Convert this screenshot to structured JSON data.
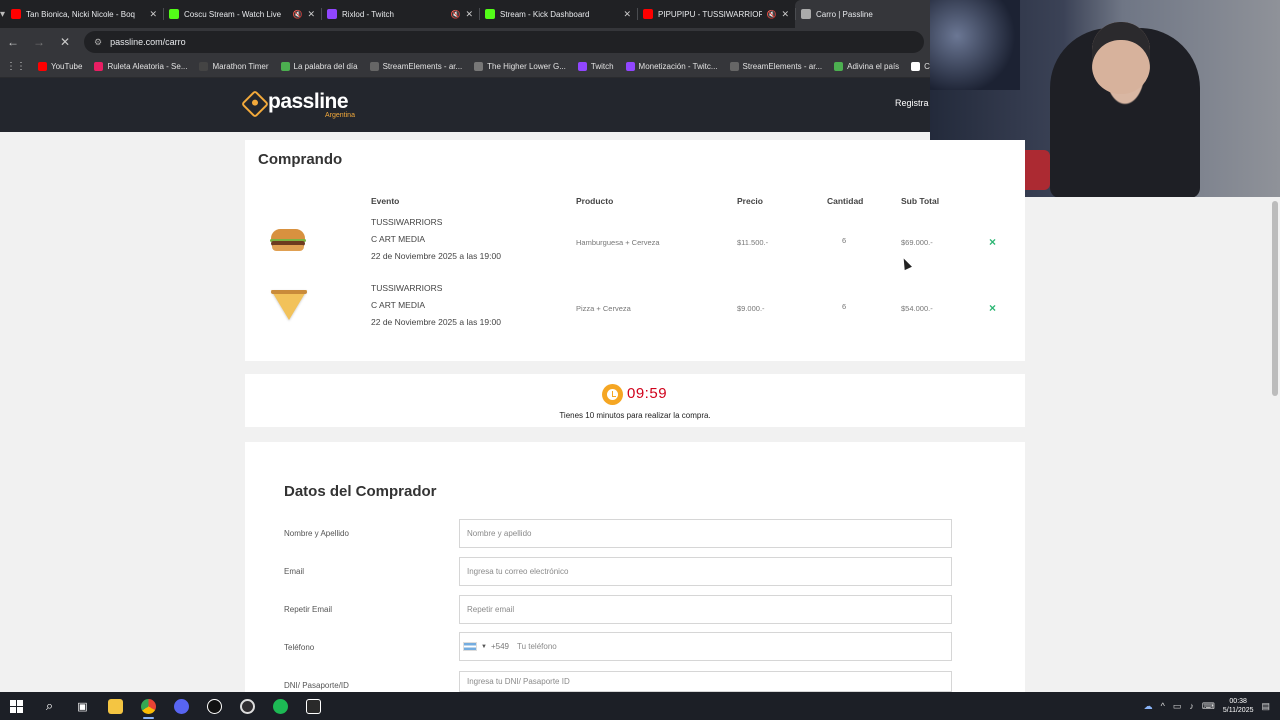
{
  "browser": {
    "tabs": [
      {
        "title": "Tan Bionica, Nicki Nicole - Boq",
        "favicon_color": "#ff0000",
        "muted": false,
        "active": false
      },
      {
        "title": "Coscu Stream - Watch Live",
        "favicon_color": "#53fc18",
        "muted": true,
        "active": false
      },
      {
        "title": "Rixlod - Twitch",
        "favicon_color": "#9146ff",
        "muted": true,
        "active": false
      },
      {
        "title": "Stream - Kick Dashboard",
        "favicon_color": "#53fc18",
        "muted": false,
        "active": false
      },
      {
        "title": "PIPUPIPU - TUSSIWARRIORS",
        "favicon_color": "#ff0000",
        "muted": true,
        "active": false
      },
      {
        "title": "Carro | Passline",
        "favicon_color": "#aaaaaa",
        "muted": false,
        "active": true
      }
    ],
    "url": "passline.com/carro",
    "bookmarks": [
      {
        "label": "YouTube",
        "color": "#ff0000"
      },
      {
        "label": "Ruleta Aleatoria - Se...",
        "color": "#e91e63"
      },
      {
        "label": "Marathon Timer",
        "color": "#444444"
      },
      {
        "label": "La palabra del día",
        "color": "#4caf50"
      },
      {
        "label": "StreamElements - ar...",
        "color": "#666666"
      },
      {
        "label": "The Higher Lower G...",
        "color": "#777777"
      },
      {
        "label": "Twitch",
        "color": "#9146ff"
      },
      {
        "label": "Monetización - Twitc...",
        "color": "#9146ff"
      },
      {
        "label": "StreamElements - ar...",
        "color": "#666666"
      },
      {
        "label": "Adivina el país",
        "color": "#4caf50"
      },
      {
        "label": "Con",
        "color": "#ffffff"
      }
    ]
  },
  "site": {
    "logo": {
      "name": "passline",
      "country": "Argentina"
    },
    "register_label": "Registra"
  },
  "cart": {
    "title": "Comprando",
    "columns": {
      "event": "Evento",
      "product": "Producto",
      "price": "Precio",
      "quantity": "Cantidad",
      "subtotal": "Sub Total"
    },
    "items": [
      {
        "image": "burger-image",
        "event_name": "TUSSIWARRIORS",
        "venue": "C ART MEDIA",
        "date": "22 de Noviembre 2025 a las 19:00",
        "product": "Hamburguesa + Cerveza",
        "price": "$11.500.-",
        "quantity": "6",
        "subtotal": "$69.000.-"
      },
      {
        "image": "pizza-image",
        "event_name": "TUSSIWARRIORS",
        "venue": "C ART MEDIA",
        "date": "22 de Noviembre 2025 a las 19:00",
        "product": "Pizza + Cerveza",
        "price": "$9.000.-",
        "quantity": "6",
        "subtotal": "$54.000.-"
      }
    ],
    "remove_symbol": "×"
  },
  "timer": {
    "value": "09:59",
    "note": "Tienes 10 minutos para realizar la compra."
  },
  "buyer": {
    "title": "Datos del Comprador",
    "fields": [
      {
        "label": "Nombre y Apellido",
        "placeholder": "Nombre y apellido"
      },
      {
        "label": "Email",
        "placeholder": "Ingresa tu correo electrónico"
      },
      {
        "label": "Repetir Email",
        "placeholder": "Repetir email"
      },
      {
        "label": "Teléfono",
        "dial_code": "+549",
        "placeholder": "Tu teléfono"
      },
      {
        "label": "DNI/ Pasaporte/ID",
        "placeholder": "Ingresa tu DNI/ Pasaporte ID"
      }
    ]
  },
  "taskbar": {
    "time": "00:38",
    "date": "5/11/2025"
  }
}
